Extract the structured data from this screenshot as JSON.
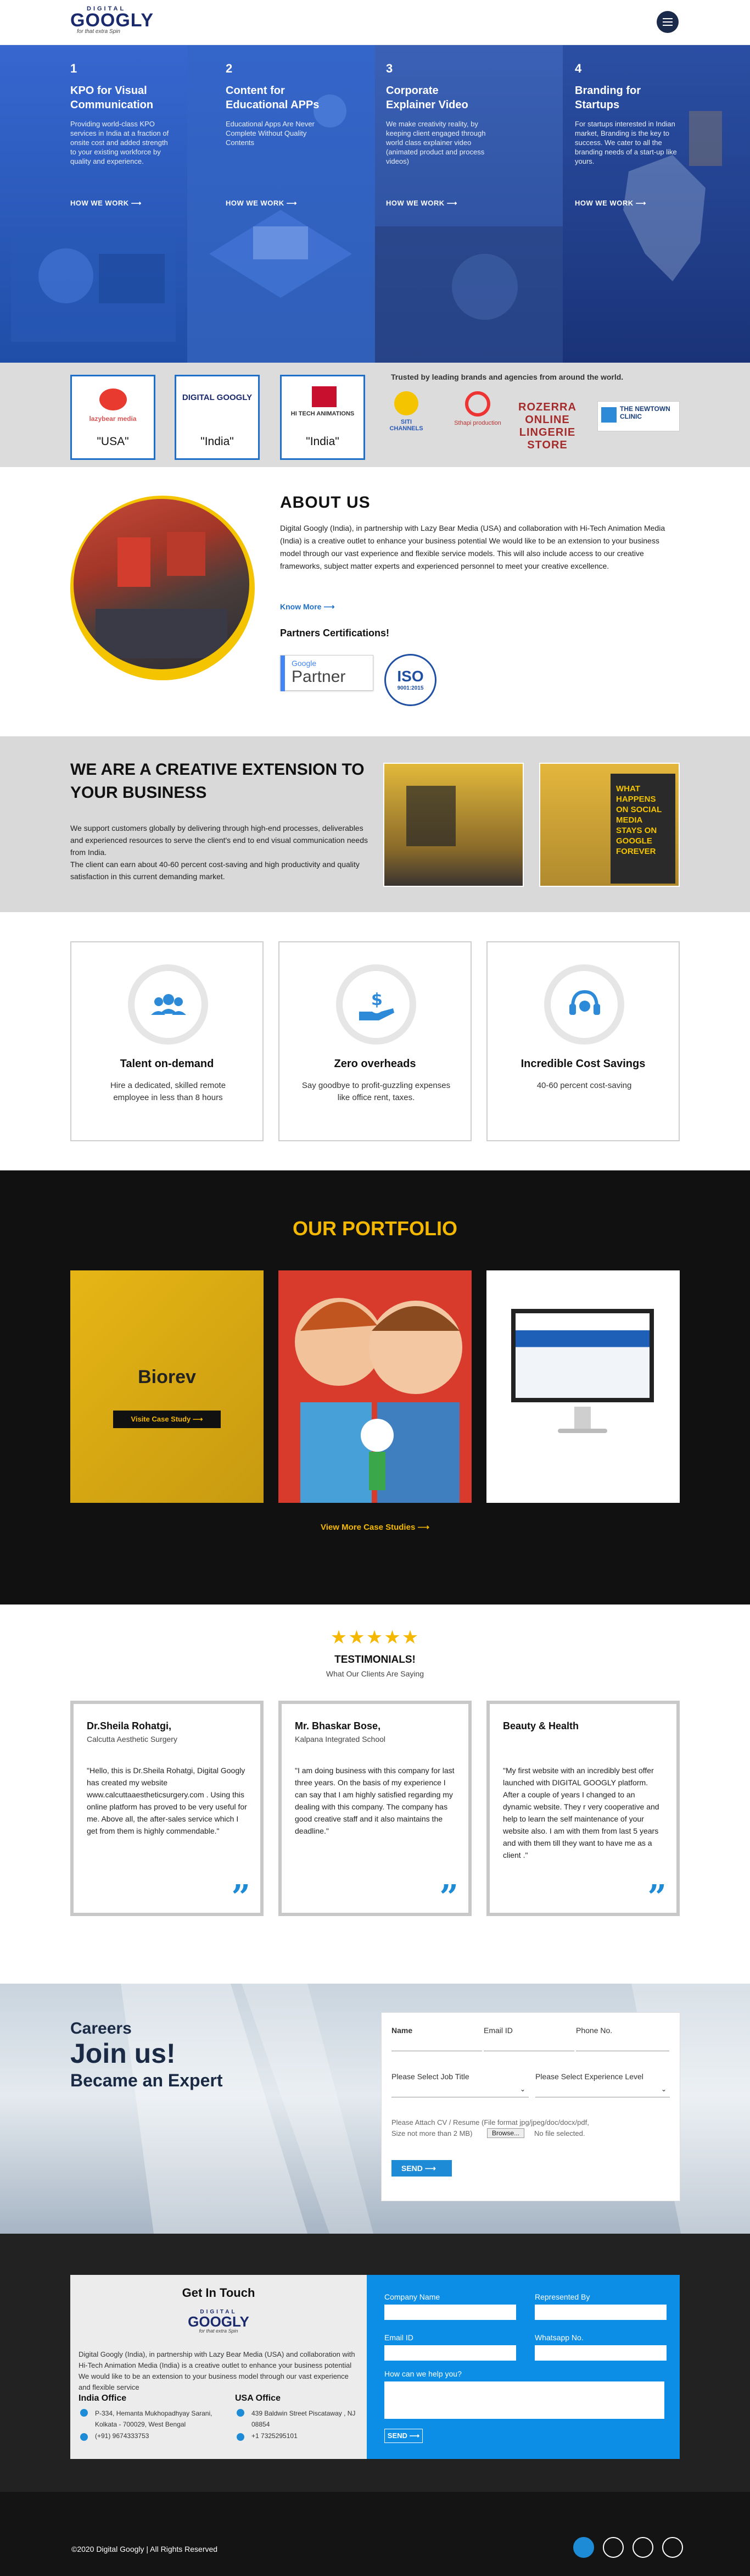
{
  "header": {
    "logo": {
      "top": "DIGITAL",
      "main": "GOOGLY",
      "tagline": "for that extra Spin"
    }
  },
  "hero": {
    "panels": [
      {
        "num": "1",
        "title": "KPO for Visual Communication",
        "desc": "Providing world-class KPO services in India at a fraction of onsite cost and added strength to your existing workforce by quality and experience.",
        "link": "HOW WE WORK",
        "color": "#2d5fc4"
      },
      {
        "num": "2",
        "title": "Content for Educational APPs",
        "desc": "Educational Apps Are Never Complete Without Quality Contents",
        "link": "HOW WE WORK",
        "color": "#2a56b9"
      },
      {
        "num": "3",
        "title": "Corporate Explainer Video",
        "desc": "We make creativity reality, by keeping client engaged through world class explainer video (animated product and process videos)",
        "link": "HOW WE WORK",
        "color": "#3b63b5"
      },
      {
        "num": "4",
        "title": "Branding for Startups",
        "desc": "For startups interested in Indian market, Branding is the key to success. We cater to all the branding needs of a start-up like yours.",
        "link": "HOW WE WORK",
        "color": "#1e3f96"
      }
    ]
  },
  "brands": {
    "trusted": "Trusted by leading brands and agencies from around the world.",
    "boxes": [
      {
        "name": "lazybear media",
        "country": "\"USA\""
      },
      {
        "name": "DIGITAL GOOGLY",
        "country": "\"India\""
      },
      {
        "name": "HI TECH ANIMATIONS",
        "country": "\"India\""
      }
    ],
    "logos": [
      "SITI CHANNELS",
      "Sthapi production",
      "ROZERRA ONLINE LINGERIE STORE",
      "THE NEWTOWN CLINIC"
    ]
  },
  "about": {
    "title": "ABOUT US",
    "text": "Digital Googly (India), in partnership with Lazy Bear Media (USA) and collaboration with Hi-Tech Animation Media (India) is a creative outlet to enhance your business potential We would like to be an extension to your business model through our vast experience and flexible service models. This will also include access to our creative frameworks, subject matter experts and experienced personnel to meet your creative excellence.",
    "know_more": "Know More",
    "certs_title": "Partners Certifications!",
    "google": "Google",
    "partner": "Partner",
    "iso": "ISO",
    "iso_year": "9001:2015"
  },
  "creative": {
    "title": "WE ARE A CREATIVE EXTENSION TO YOUR BUSINESS",
    "text": "We support customers globally by delivering through high-end processes, deliverables and experienced resources to serve the client's end to end visual communication needs from India.\nThe client can earn about 40-60 percent cost-saving and high productivity and quality satisfaction in this current demanding market.",
    "wall_text": "WHAT HAPPENS ON SOCIAL MEDIA STAYS ON GOOGLE FOREVER"
  },
  "features": [
    {
      "title": "Talent on-demand",
      "desc": "Hire a dedicated, skilled remote employee in less than 8 hours",
      "icon": "users-icon"
    },
    {
      "title": "Zero overheads",
      "desc": "Say goodbye to profit-guzzling expenses like office rent, taxes.",
      "icon": "money-hand-icon"
    },
    {
      "title": "Incredible Cost Savings",
      "desc": "40-60 percent cost-saving",
      "icon": "headset-icon"
    }
  ],
  "portfolio": {
    "title": "OUR PORTFOLIO",
    "case_title": "Biorev",
    "case_btn": "Visite Case Study",
    "view_more": "View More Case Studies"
  },
  "testimonials": {
    "stars": "★★★★★",
    "title": "TESTIMONIALS!",
    "subtitle": "What Our Clients Are Saying",
    "items": [
      {
        "name": "Dr.Sheila Rohatgi,",
        "org": "Calcutta Aesthetic Surgery",
        "quote": "\"Hello, this is Dr.Sheila Rohatgi, Digital Googly has created my website www.calcuttaaestheticsurgery.com . Using this online platform has proved to be very useful for me. Above all, the after-sales service which I get from them is highly commendable.\""
      },
      {
        "name": "Mr. Bhaskar Bose,",
        "org": "Kalpana Integrated School",
        "quote": "\"I am doing business with this company for last three years. On the basis of my experience I can say that I am highly satisfied regarding my dealing with this company. The company has good creative staff and it also maintains the deadline.\""
      },
      {
        "name": "Beauty & Health",
        "org": "",
        "quote": "\"My first website with an incredibly best offer launched with DIGITAL GOOGLY platform. After a couple of years I changed to an dynamic website. They r very cooperative and help to learn the self maintenance of your website also. I am with them from last 5 years and with them till they want to have me as a client .\""
      }
    ]
  },
  "careers": {
    "k1": "Careers",
    "k2": "Join us!",
    "k3": "Became an Expert",
    "name": "Name",
    "email": "Email ID",
    "phone": "Phone No.",
    "job": "Please Select Job Title",
    "exp": "Please Select Experience Level",
    "attach": "Please Attach CV / Resume (File format jpg/jpeg/doc/docx/pdf,",
    "size": "Size not more than 2 MB)",
    "browse": "Browse...",
    "nofile": "No file selected.",
    "send": "SEND"
  },
  "contact": {
    "title": "Get In Touch",
    "text": "Digital Googly (India), in partnership with Lazy Bear Media (USA) and collaboration with Hi-Tech Animation Media (India) is a creative outlet to enhance your business potential We would like to be an extension to your business model through our vast experience and flexible service",
    "india": "India Office",
    "usa": "USA Office",
    "india_addr": "P-334, Hemanta Mukhopadhyay Sarani, Kolkata - 700029, West Bengal",
    "india_phone": "(+91) 9674333753",
    "usa_addr": "439 Baldwin Street Piscataway , NJ 08854",
    "usa_phone": "+1 7325295101",
    "company": "Company Name",
    "rep": "Represented By",
    "email": "Email ID",
    "whatsapp": "Whatsapp No.",
    "help": "How can we help you?",
    "send": "SEND"
  },
  "footer": {
    "copy": "©2020 Digital Googly | All Rights Reserved"
  }
}
